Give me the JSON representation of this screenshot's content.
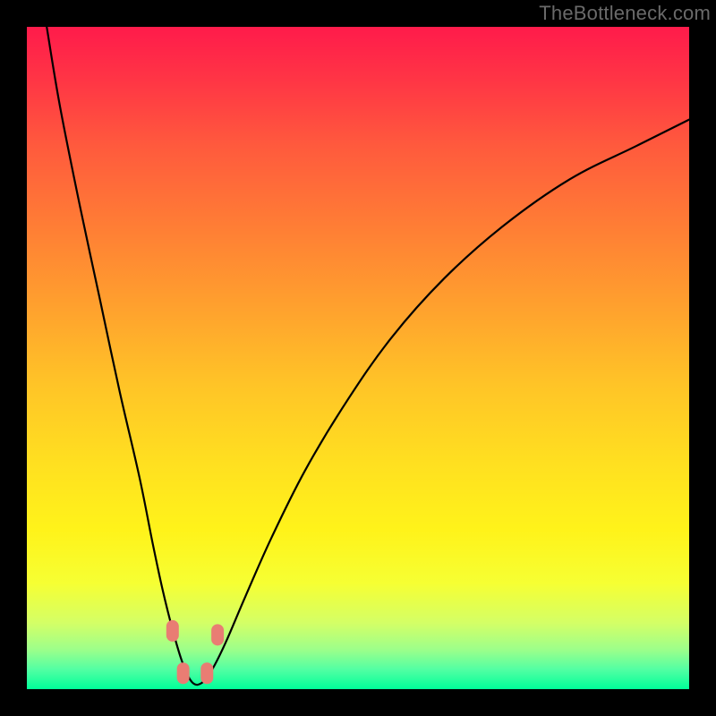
{
  "watermark": {
    "text": "TheBottleneck.com"
  },
  "colors": {
    "page_bg": "#000000",
    "curve_stroke": "#000000",
    "marker_fill": "#e97d73",
    "gradient_top": "#ff1b4b",
    "gradient_bottom": "#00ff99"
  },
  "chart_data": {
    "type": "line",
    "title": "",
    "xlabel": "",
    "ylabel": "",
    "xlim": [
      0,
      100
    ],
    "ylim": [
      0,
      100
    ],
    "grid": false,
    "legend": false,
    "series": [
      {
        "name": "bottleneck-curve",
        "x": [
          3,
          5,
          8,
          11,
          14,
          17,
          19,
          20.5,
          22,
          23.5,
          25,
          26.5,
          28,
          30,
          33,
          37,
          42,
          48,
          55,
          63,
          72,
          82,
          92,
          100
        ],
        "y": [
          100,
          88,
          73,
          59,
          45,
          32,
          22,
          15,
          9,
          4,
          1,
          1,
          3,
          7,
          14,
          23,
          33,
          43,
          53,
          62,
          70,
          77,
          82,
          86
        ]
      }
    ],
    "markers": [
      {
        "name": "left-upper",
        "x": 22.0,
        "y": 8.8
      },
      {
        "name": "left-lower",
        "x": 23.6,
        "y": 2.4
      },
      {
        "name": "right-lower",
        "x": 27.2,
        "y": 2.4
      },
      {
        "name": "right-upper",
        "x": 28.8,
        "y": 8.2
      }
    ]
  }
}
